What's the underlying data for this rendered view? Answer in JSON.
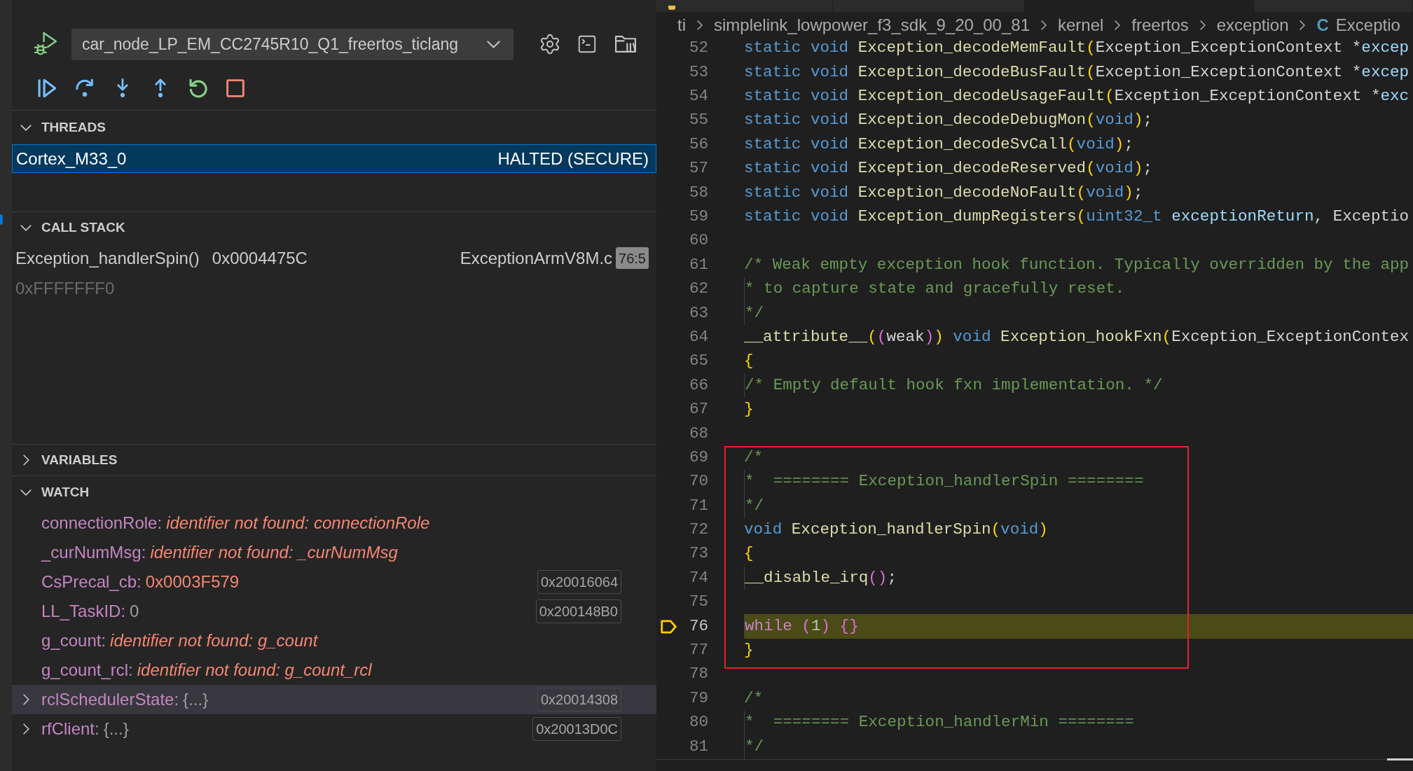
{
  "debug_toolbar": {
    "configuration": "car_node_LP_EM_CC2745R10_Q1_freertos_ticlang"
  },
  "sections": [
    {
      "kind": "threads",
      "title": "THREADS",
      "expanded": true,
      "threads": [
        {
          "name": "Cortex_M33_0",
          "status": "HALTED (SECURE)",
          "selected": true
        }
      ]
    },
    {
      "kind": "call_stack",
      "title": "CALL STACK",
      "expanded": true,
      "frames": [
        {
          "function": "Exception_handlerSpin()",
          "address": "0x0004475C",
          "file": "ExceptionArmV8M.c",
          "position": "76:5",
          "dimmed": false
        },
        {
          "address": "0xFFFFFFF0",
          "dimmed": true
        }
      ]
    },
    {
      "kind": "variables",
      "title": "VARIABLES",
      "expanded": false
    },
    {
      "kind": "watch",
      "title": "WATCH",
      "expanded": true,
      "items": [
        {
          "name": "connectionRole:",
          "value": "identifier not found: connectionRole",
          "kind": "error",
          "expandable": false,
          "selected": false
        },
        {
          "name": "_curNumMsg:",
          "value": "identifier not found: _curNumMsg",
          "kind": "error",
          "expandable": false,
          "selected": false
        },
        {
          "name": "CsPrecal_cb:",
          "value": "0x0003F579",
          "kind": "pointer",
          "address": "0x20016064",
          "expandable": false,
          "selected": false
        },
        {
          "name": "LL_TaskID:",
          "value": "0",
          "kind": "number",
          "address": "0x200148B0",
          "expandable": false,
          "selected": false
        },
        {
          "name": "g_count:",
          "value": "identifier not found: g_count",
          "kind": "error",
          "expandable": false,
          "selected": false
        },
        {
          "name": "g_count_rcl:",
          "value": "identifier not found: g_count_rcl",
          "kind": "error",
          "expandable": false,
          "selected": false
        },
        {
          "name": "rclSchedulerState:",
          "value": "{...}",
          "kind": "object",
          "address": "0x20014308",
          "expandable": true,
          "selected": true
        },
        {
          "name": "rfClient:",
          "value": "{...}",
          "kind": "object",
          "address": "0x20013D0C",
          "expandable": true,
          "selected": false
        }
      ]
    }
  ],
  "editor": {
    "tabs": [
      {
        "selected": false,
        "icon": true
      },
      {
        "selected": false,
        "icon": false
      },
      {
        "selected": true,
        "icon": false
      },
      {
        "selected": false,
        "icon": false
      }
    ],
    "breadcrumb": [
      {
        "text": "ti"
      },
      {
        "text": "simplelink_lowpower_f3_sdk_9_20_00_81"
      },
      {
        "text": "kernel"
      },
      {
        "text": "freertos"
      },
      {
        "text": "exception"
      },
      {
        "icon": "C",
        "text": "Exceptio"
      }
    ],
    "blocks": [
      {
        "boxed": false,
        "lines": [
          {
            "number": "52",
            "current": false,
            "tokens": [
              {
                "text": "static void",
                "kind": "keyword"
              },
              {
                "text": " Exception_decodeMemFault",
                "kind": "function"
              },
              {
                "text": "(",
                "kind": "bracket1"
              },
              {
                "text": "Exception_ExceptionContext *",
                "kind": "plain"
              },
              {
                "text": "excep",
                "kind": "param"
              }
            ]
          },
          {
            "number": "53",
            "current": false,
            "tokens": [
              {
                "text": "static void",
                "kind": "keyword"
              },
              {
                "text": " Exception_decodeBusFault",
                "kind": "function"
              },
              {
                "text": "(",
                "kind": "bracket1"
              },
              {
                "text": "Exception_ExceptionContext *",
                "kind": "plain"
              },
              {
                "text": "excep",
                "kind": "param"
              }
            ]
          },
          {
            "number": "54",
            "current": false,
            "tokens": [
              {
                "text": "static void",
                "kind": "keyword"
              },
              {
                "text": " Exception_decodeUsageFault",
                "kind": "function"
              },
              {
                "text": "(",
                "kind": "bracket1"
              },
              {
                "text": "Exception_ExceptionContext *",
                "kind": "plain"
              },
              {
                "text": "exc",
                "kind": "param"
              }
            ]
          },
          {
            "number": "55",
            "current": false,
            "tokens": [
              {
                "text": "static void",
                "kind": "keyword"
              },
              {
                "text": " Exception_decodeDebugMon",
                "kind": "function"
              },
              {
                "text": "(",
                "kind": "bracket1"
              },
              {
                "text": "void",
                "kind": "keyword"
              },
              {
                "text": ")",
                "kind": "bracket1"
              },
              {
                "text": ";",
                "kind": "plain"
              }
            ]
          },
          {
            "number": "56",
            "current": false,
            "tokens": [
              {
                "text": "static void",
                "kind": "keyword"
              },
              {
                "text": " Exception_decodeSvCall",
                "kind": "function"
              },
              {
                "text": "(",
                "kind": "bracket1"
              },
              {
                "text": "void",
                "kind": "keyword"
              },
              {
                "text": ")",
                "kind": "bracket1"
              },
              {
                "text": ";",
                "kind": "plain"
              }
            ]
          },
          {
            "number": "57",
            "current": false,
            "tokens": [
              {
                "text": "static void",
                "kind": "keyword"
              },
              {
                "text": " Exception_decodeReserved",
                "kind": "function"
              },
              {
                "text": "(",
                "kind": "bracket1"
              },
              {
                "text": "void",
                "kind": "keyword"
              },
              {
                "text": ")",
                "kind": "bracket1"
              },
              {
                "text": ";",
                "kind": "plain"
              }
            ]
          },
          {
            "number": "58",
            "current": false,
            "tokens": [
              {
                "text": "static void",
                "kind": "keyword"
              },
              {
                "text": " Exception_decodeNoFault",
                "kind": "function"
              },
              {
                "text": "(",
                "kind": "bracket1"
              },
              {
                "text": "void",
                "kind": "keyword"
              },
              {
                "text": ")",
                "kind": "bracket1"
              },
              {
                "text": ";",
                "kind": "plain"
              }
            ]
          },
          {
            "number": "59",
            "current": false,
            "tokens": [
              {
                "text": "static void",
                "kind": "keyword"
              },
              {
                "text": " Exception_dumpRegisters",
                "kind": "function"
              },
              {
                "text": "(",
                "kind": "bracket1"
              },
              {
                "text": "uint32_t",
                "kind": "keyword"
              },
              {
                "text": " exceptionReturn",
                "kind": "param"
              },
              {
                "text": ", Exceptio",
                "kind": "plain"
              }
            ]
          },
          {
            "number": "60",
            "current": false
          },
          {
            "number": "61",
            "current": false,
            "tokens": [
              {
                "text": "/* Weak empty exception hook function. Typically overridden by the app",
                "kind": "comment"
              }
            ]
          },
          {
            "number": "62",
            "current": false,
            "tokens": [
              {
                "text": " * to capture state and gracefully reset.",
                "kind": "comment"
              }
            ]
          },
          {
            "number": "63",
            "current": false,
            "tokens": [
              {
                "text": " */",
                "kind": "comment"
              }
            ]
          },
          {
            "number": "64",
            "current": false,
            "tokens": [
              {
                "text": "__attribute__",
                "kind": "function"
              },
              {
                "text": "(",
                "kind": "bracket1"
              },
              {
                "text": "(",
                "kind": "bracket2"
              },
              {
                "text": "weak",
                "kind": "plain"
              },
              {
                "text": ")",
                "kind": "bracket2"
              },
              {
                "text": ")",
                "kind": "bracket1"
              },
              {
                "text": " void",
                "kind": "keyword"
              },
              {
                "text": " Exception_hookFxn",
                "kind": "function"
              },
              {
                "text": "(",
                "kind": "bracket1"
              },
              {
                "text": "Exception_ExceptionContex",
                "kind": "plain"
              }
            ]
          },
          {
            "number": "65",
            "current": false,
            "tokens": [
              {
                "text": "{",
                "kind": "bracket1"
              }
            ]
          },
          {
            "number": "66",
            "current": false,
            "tokens": [
              {
                "text": "    /* Empty default hook fxn implementation. */",
                "kind": "comment"
              }
            ]
          },
          {
            "number": "67",
            "current": false,
            "tokens": [
              {
                "text": "}",
                "kind": "bracket1"
              }
            ]
          },
          {
            "number": "68",
            "current": false
          }
        ]
      },
      {
        "boxed": true,
        "lines": [
          {
            "number": "69",
            "current": false,
            "tokens": [
              {
                "text": "/*",
                "kind": "comment"
              }
            ]
          },
          {
            "number": "70",
            "current": false,
            "tokens": [
              {
                "text": " *  ======== Exception_handlerSpin ========",
                "kind": "comment"
              }
            ]
          },
          {
            "number": "71",
            "current": false,
            "tokens": [
              {
                "text": " */",
                "kind": "comment"
              }
            ]
          },
          {
            "number": "72",
            "current": false,
            "tokens": [
              {
                "text": "void",
                "kind": "keyword"
              },
              {
                "text": " Exception_handlerSpin",
                "kind": "function"
              },
              {
                "text": "(",
                "kind": "bracket1"
              },
              {
                "text": "void",
                "kind": "keyword"
              },
              {
                "text": ")",
                "kind": "bracket1"
              }
            ]
          },
          {
            "number": "73",
            "current": false,
            "tokens": [
              {
                "text": "{",
                "kind": "bracket1"
              }
            ]
          },
          {
            "number": "74",
            "current": false,
            "tokens": [
              {
                "text": "    __disable_irq",
                "kind": "function"
              },
              {
                "text": "(",
                "kind": "bracket2"
              },
              {
                "text": ")",
                "kind": "bracket2"
              },
              {
                "text": ";",
                "kind": "plain"
              }
            ]
          },
          {
            "number": "75",
            "current": false
          },
          {
            "number": "76",
            "current": true,
            "tokens": [
              {
                "text": "    while",
                "kind": "control"
              },
              {
                "text": " (",
                "kind": "bracket2"
              },
              {
                "text": "1",
                "kind": "number"
              },
              {
                "text": ")",
                "kind": "bracket2"
              },
              {
                "text": " {}",
                "kind": "bracket2"
              }
            ]
          },
          {
            "number": "77",
            "current": false,
            "tokens": [
              {
                "text": "}",
                "kind": "bracket1"
              }
            ]
          }
        ]
      },
      {
        "boxed": false,
        "lines": [
          {
            "number": "78",
            "current": false
          },
          {
            "number": "79",
            "current": false,
            "tokens": [
              {
                "text": "/*",
                "kind": "comment"
              }
            ]
          },
          {
            "number": "80",
            "current": false,
            "tokens": [
              {
                "text": " *  ======== Exception_handlerMin ========",
                "kind": "comment"
              }
            ]
          },
          {
            "number": "81",
            "current": false,
            "tokens": [
              {
                "text": " */",
                "kind": "comment"
              }
            ]
          }
        ]
      }
    ]
  }
}
